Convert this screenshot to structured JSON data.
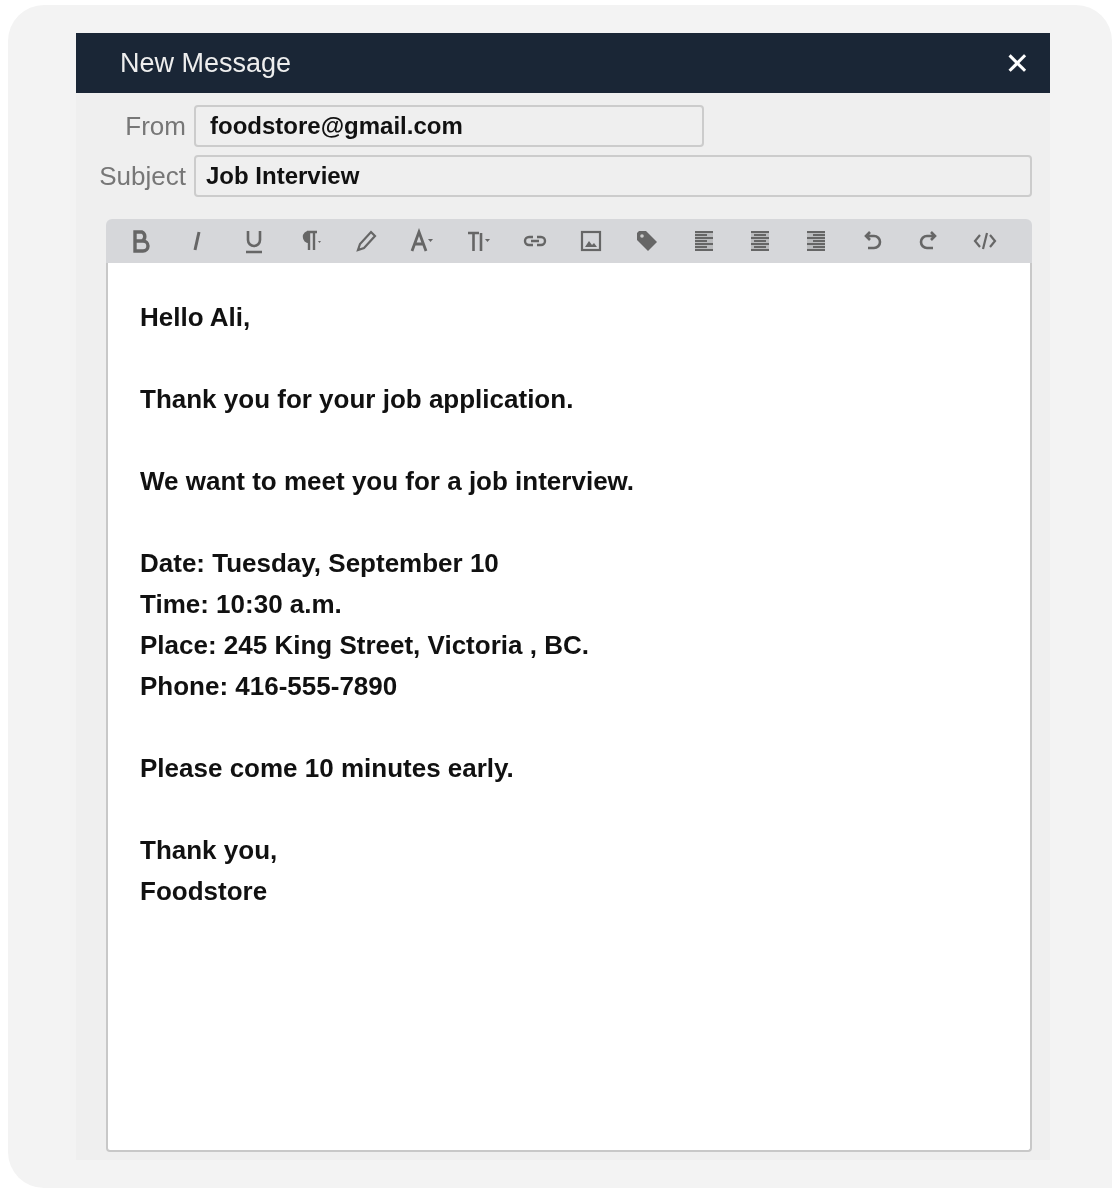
{
  "window": {
    "title": "New Message",
    "close": "✕"
  },
  "fields": [
    {
      "label": "From",
      "value": "foodstore@gmail.com",
      "kind": "short"
    },
    {
      "label": "Subject",
      "value": "Job Interview",
      "kind": "wide"
    }
  ],
  "body": [
    [
      "Hello Ali,"
    ],
    [
      "Thank you for your job application."
    ],
    [
      "We want to meet you for a job interview."
    ],
    [
      "Date: Tuesday, September 10",
      "Time: 10:30 a.m.",
      "Place: 245 King Street,  Victoria , BC.",
      "Phone: 416-555-7890"
    ],
    [
      "Please come 10 minutes early."
    ],
    [
      "Thank you,",
      "Foodstore"
    ]
  ]
}
